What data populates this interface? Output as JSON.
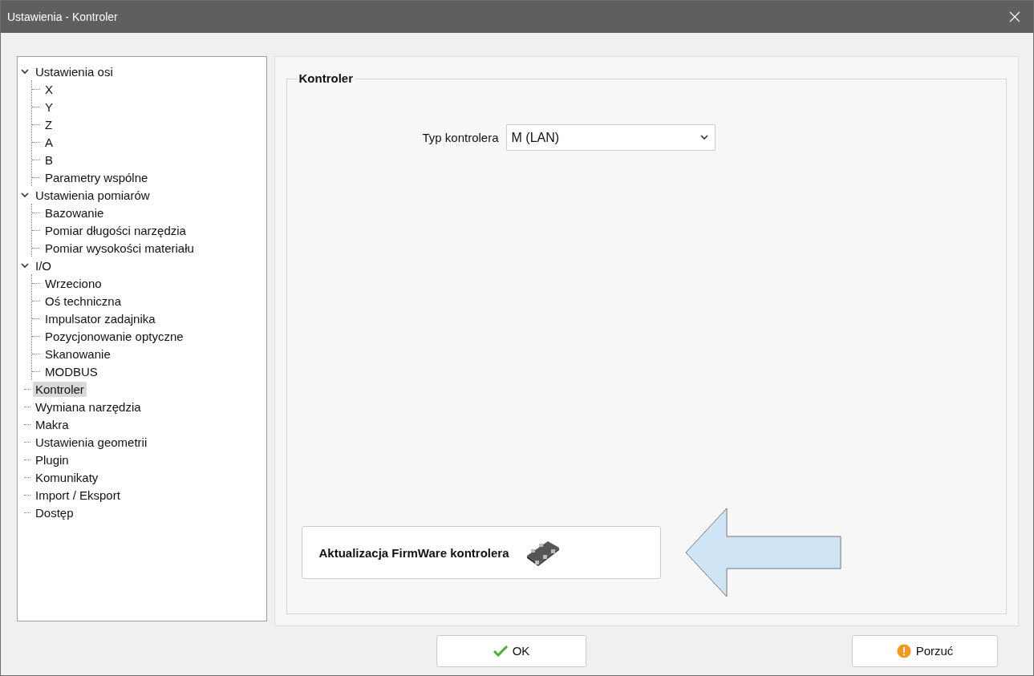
{
  "window": {
    "title": "Ustawienia - Kontroler"
  },
  "tree": [
    {
      "label": "Ustawienia osi",
      "expanded": true,
      "selected": false,
      "children": [
        {
          "label": "X",
          "selected": false
        },
        {
          "label": "Y",
          "selected": false
        },
        {
          "label": "Z",
          "selected": false
        },
        {
          "label": "A",
          "selected": false
        },
        {
          "label": "B",
          "selected": false
        },
        {
          "label": "Parametry wspólne",
          "selected": false
        }
      ]
    },
    {
      "label": "Ustawienia pomiarów",
      "expanded": true,
      "selected": false,
      "children": [
        {
          "label": "Bazowanie",
          "selected": false
        },
        {
          "label": "Pomiar długości narzędzia",
          "selected": false
        },
        {
          "label": "Pomiar wysokości materiału",
          "selected": false
        }
      ]
    },
    {
      "label": "I/O",
      "expanded": true,
      "selected": false,
      "children": [
        {
          "label": "Wrzeciono",
          "selected": false
        },
        {
          "label": "Oś techniczna",
          "selected": false
        },
        {
          "label": "Impulsator zadajnika",
          "selected": false
        },
        {
          "label": "Pozycjonowanie optyczne",
          "selected": false
        },
        {
          "label": "Skanowanie",
          "selected": false
        },
        {
          "label": "MODBUS",
          "selected": false
        }
      ]
    },
    {
      "label": "Kontroler",
      "selected": true
    },
    {
      "label": "Wymiana narzędzia",
      "selected": false
    },
    {
      "label": "Makra",
      "selected": false
    },
    {
      "label": "Ustawienia geometrii",
      "selected": false
    },
    {
      "label": "Plugin",
      "selected": false
    },
    {
      "label": "Komunikaty",
      "selected": false
    },
    {
      "label": "Import / Eksport",
      "selected": false
    },
    {
      "label": "Dostęp",
      "selected": false
    }
  ],
  "group": {
    "title": "Kontroler",
    "field": {
      "label": "Typ kontrolera",
      "value": "M (LAN)"
    },
    "firmware_button": "Aktualizacja FirmWare kontrolera"
  },
  "buttons": [
    {
      "label": "OK",
      "kind": "ok"
    },
    {
      "label": "Porzuć",
      "kind": "cancel"
    }
  ]
}
